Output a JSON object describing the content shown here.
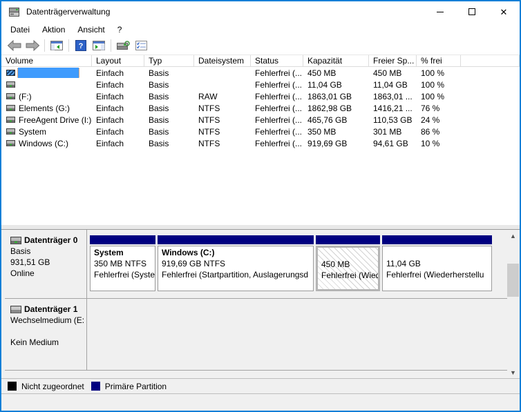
{
  "window": {
    "title": "Datenträgerverwaltung"
  },
  "menu": {
    "items": [
      "Datei",
      "Aktion",
      "Ansicht",
      "?"
    ]
  },
  "toolbar": {
    "icons": [
      "back-arrow",
      "forward-arrow",
      "console-tree-toggle",
      "help",
      "action-pane-toggle",
      "disk-console",
      "column-options"
    ]
  },
  "volume_table": {
    "columns": [
      "Volume",
      "Layout",
      "Typ",
      "Dateisystem",
      "Status",
      "Kapazität",
      "Freier Sp...",
      "% frei"
    ],
    "rows": [
      {
        "name": "",
        "layout": "Einfach",
        "type": "Basis",
        "fs": "",
        "status": "Fehlerfrei (...",
        "capacity": "450 MB",
        "free": "450 MB",
        "pct": "100 %",
        "selected": true
      },
      {
        "name": "",
        "layout": "Einfach",
        "type": "Basis",
        "fs": "",
        "status": "Fehlerfrei (...",
        "capacity": "11,04 GB",
        "free": "11,04 GB",
        "pct": "100 %",
        "selected": false
      },
      {
        "name": "(F:)",
        "layout": "Einfach",
        "type": "Basis",
        "fs": "RAW",
        "status": "Fehlerfrei (...",
        "capacity": "1863,01 GB",
        "free": "1863,01 ...",
        "pct": "100 %",
        "selected": false
      },
      {
        "name": "Elements (G:)",
        "layout": "Einfach",
        "type": "Basis",
        "fs": "NTFS",
        "status": "Fehlerfrei (...",
        "capacity": "1862,98 GB",
        "free": "1416,21 ...",
        "pct": "76 %",
        "selected": false
      },
      {
        "name": "FreeAgent Drive (I:)",
        "layout": "Einfach",
        "type": "Basis",
        "fs": "NTFS",
        "status": "Fehlerfrei (...",
        "capacity": "465,76 GB",
        "free": "110,53 GB",
        "pct": "24 %",
        "selected": false
      },
      {
        "name": "System",
        "layout": "Einfach",
        "type": "Basis",
        "fs": "NTFS",
        "status": "Fehlerfrei (...",
        "capacity": "350 MB",
        "free": "301 MB",
        "pct": "86 %",
        "selected": false
      },
      {
        "name": "Windows (C:)",
        "layout": "Einfach",
        "type": "Basis",
        "fs": "NTFS",
        "status": "Fehlerfrei (...",
        "capacity": "919,69 GB",
        "free": "94,61 GB",
        "pct": "10 %",
        "selected": false
      }
    ]
  },
  "disks": [
    {
      "name": "Datenträger 0",
      "type": "Basis",
      "size": "931,51 GB",
      "status": "Online",
      "partitions": [
        {
          "name": "System",
          "line2": "350 MB NTFS",
          "line3": "Fehlerfrei (Syste",
          "selected": false
        },
        {
          "name": "Windows  (C:)",
          "line2": "919,69 GB NTFS",
          "line3": "Fehlerfrei (Startpartition, Auslagerungsd",
          "selected": false
        },
        {
          "name": "",
          "line2": "450 MB",
          "line3": "Fehlerfrei (Wied",
          "selected": true
        },
        {
          "name": "",
          "line2": "11,04 GB",
          "line3": "Fehlerfrei (Wiederherstellu",
          "selected": false
        }
      ]
    },
    {
      "name": "Datenträger 1",
      "type": "Wechselmedium (E:",
      "size": "",
      "status": "Kein Medium",
      "partitions": []
    }
  ],
  "legend": {
    "items": [
      {
        "label": "Nicht zugeordnet",
        "color": "#000000"
      },
      {
        "label": "Primäre Partition",
        "color": "#000080"
      }
    ]
  },
  "colors": {
    "window_border": "#0f7fd7",
    "selection_blue": "#3f9bfd",
    "primary_partition": "#000080",
    "unallocated": "#000000",
    "pane_background": "#f0f0f0"
  }
}
